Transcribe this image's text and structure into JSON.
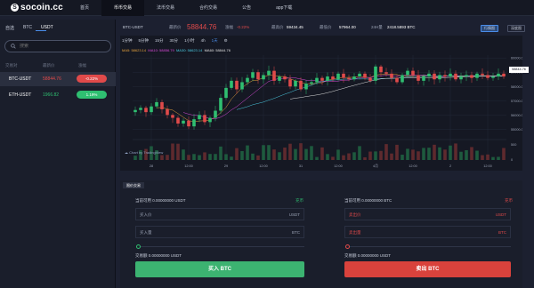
{
  "nav": {
    "brand": "socoin.cc",
    "items": [
      "首页",
      "币币交易",
      "法币交易",
      "合约交易",
      "公告",
      "app下载"
    ]
  },
  "sidebar": {
    "tabs": [
      "自选",
      "BTC",
      "USDT"
    ],
    "search_placeholder": "搜索",
    "columns": [
      "交易对",
      "最新价",
      "涨幅"
    ],
    "rows": [
      {
        "pair": "BTC-USDT",
        "price": "58844.76",
        "change": "-0.22%",
        "color": "#e04a4a"
      },
      {
        "pair": "ETH-USDT",
        "price": "1966.82",
        "change": "1.19%",
        "color": "#2fbf71"
      }
    ]
  },
  "ticker": {
    "pair": "BTC-USDT",
    "last_label": "最新价",
    "last": "58844.76",
    "change_label": "涨幅",
    "change": "-0.22%",
    "high_label": "最高价",
    "high": "59434.45",
    "low_label": "最低价",
    "low": "57964.00",
    "vol_label": "24H量",
    "vol": "2418.5893 BTC",
    "btn1": "行情图",
    "btn2": "深度图"
  },
  "chart_toolbar": [
    "1分钟",
    "5分钟",
    "15分",
    "30分",
    "1小时",
    "4h",
    "1天"
  ],
  "ma_legend": {
    "ma5": "MA5: 58623.14",
    "ma10": "MA10: 58856.79",
    "ma30": "MA30: 58623.14",
    "ma60": "MA60: 58844.76"
  },
  "chart_price_tag": "58844.76",
  "chart_attrib": "Chart by TradingView",
  "order": {
    "tab": "限价交易",
    "buy": {
      "avail": "当前可用 0.00000000 USDT",
      "recharge": "充币",
      "price_label": "买入价",
      "price_unit": "USDT",
      "amount_label": "买入量",
      "amount_unit": "BTC",
      "total": "交易额 0.00000000 USDT",
      "button": "买入 BTC"
    },
    "sell": {
      "avail": "当前可用 0.00000000 BTC",
      "recharge": "充币",
      "price_label": "卖出价",
      "price_unit": "USDT",
      "amount_label": "卖出量",
      "amount_unit": "BTC",
      "total": "交易额 0.00000000 USDT",
      "button": "卖出 BTC"
    }
  },
  "chart_data": {
    "type": "candlestick",
    "ylabel": "USDT",
    "ylim": [
      54400,
      60200
    ],
    "y_ticks": [
      55000,
      56000,
      57000,
      58000,
      59000,
      60000
    ],
    "x_ticks": [
      "28",
      "12:00",
      "29",
      "12:00",
      "31",
      "12:00",
      "4月",
      "12:00",
      "2",
      "12:00"
    ],
    "volume_ticks": [
      "500",
      "0"
    ],
    "close_series": [
      56350,
      56500,
      56200,
      56600,
      56900,
      56400,
      56000,
      55800,
      55400,
      55600,
      55200,
      55700,
      56000,
      55500,
      55800,
      56300,
      57200,
      57900,
      58400,
      57800,
      58300,
      58600,
      59000,
      58500,
      58800,
      59100,
      58400,
      58700,
      58500,
      58000,
      58400,
      57800,
      58200,
      58300,
      58600,
      58400,
      58700,
      58500,
      58900,
      58600,
      58500,
      58700,
      58900,
      58600,
      58400,
      59400,
      59000,
      58900,
      58600,
      58300,
      58800,
      59100,
      58800,
      58400,
      58700,
      58900,
      58500,
      58800,
      58700,
      58900,
      58500,
      58700,
      58800,
      58600,
      58900,
      58800,
      58600,
      58700,
      58900,
      58700
    ]
  }
}
